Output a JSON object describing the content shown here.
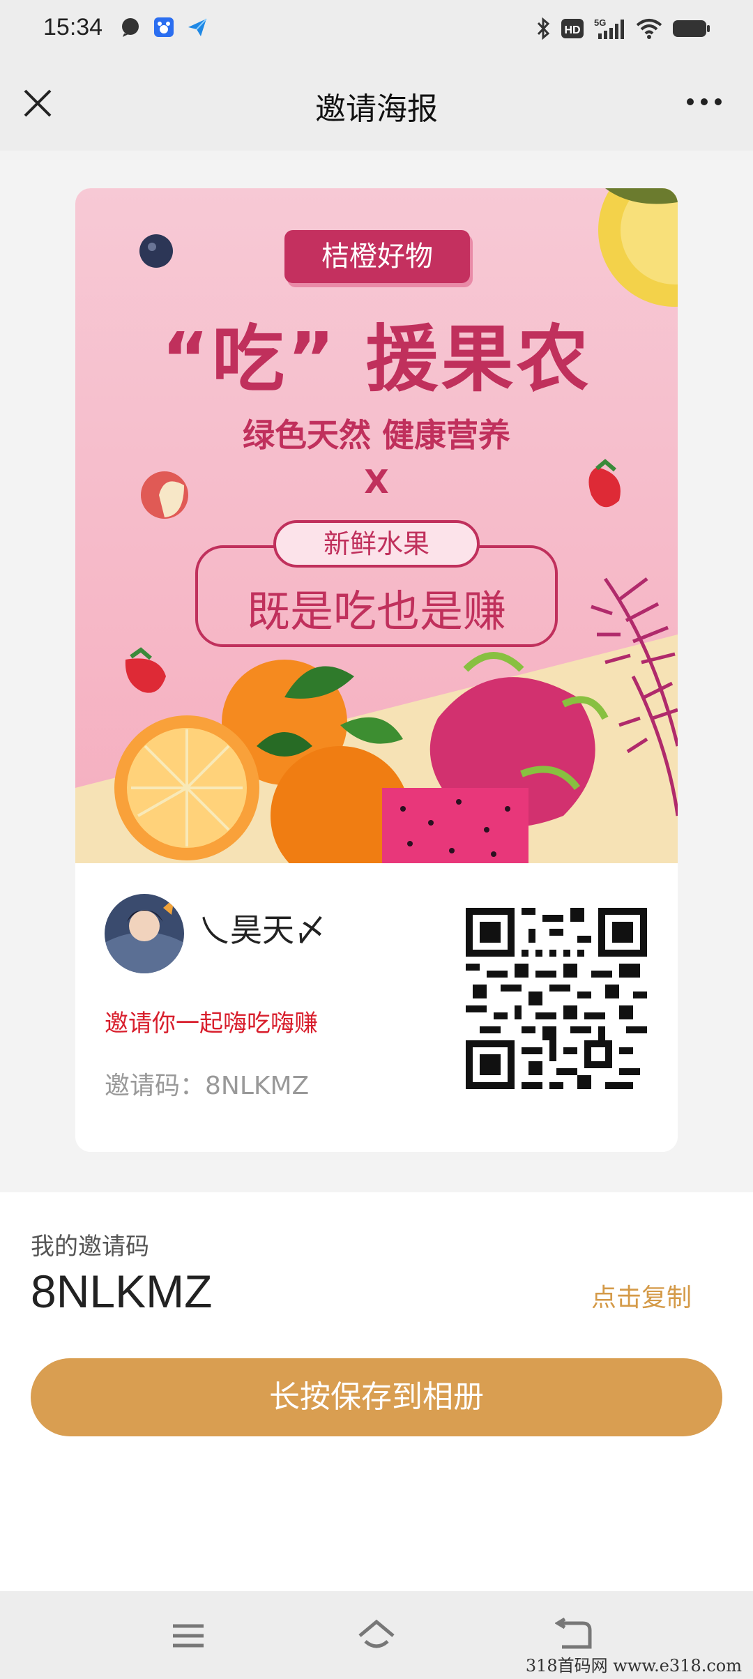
{
  "status_bar": {
    "time": "15:34"
  },
  "nav": {
    "title": "邀请海报"
  },
  "poster": {
    "brand_badge": "桔橙好物",
    "headline": "“吃” 援果农",
    "subtitle": "绿色天然 健康营养",
    "x_mark": "X",
    "pill_label": "新鲜水果",
    "slogan": "既是吃也是赚",
    "user_name": "乀昊天〆",
    "invite_message": "邀请你一起嗨吃嗨赚",
    "invite_code_label": "邀请码：8NLKMZ"
  },
  "panel": {
    "my_code_label": "我的邀请码",
    "my_code_value": "8NLKMZ",
    "copy_label": "点击复制",
    "save_button": "长按保存到相册"
  },
  "watermark": "318首码网  www.e318.com",
  "colors": {
    "accent": "#d99e51",
    "poster_pink": "#c0305c",
    "red_text": "#d81e2c"
  }
}
